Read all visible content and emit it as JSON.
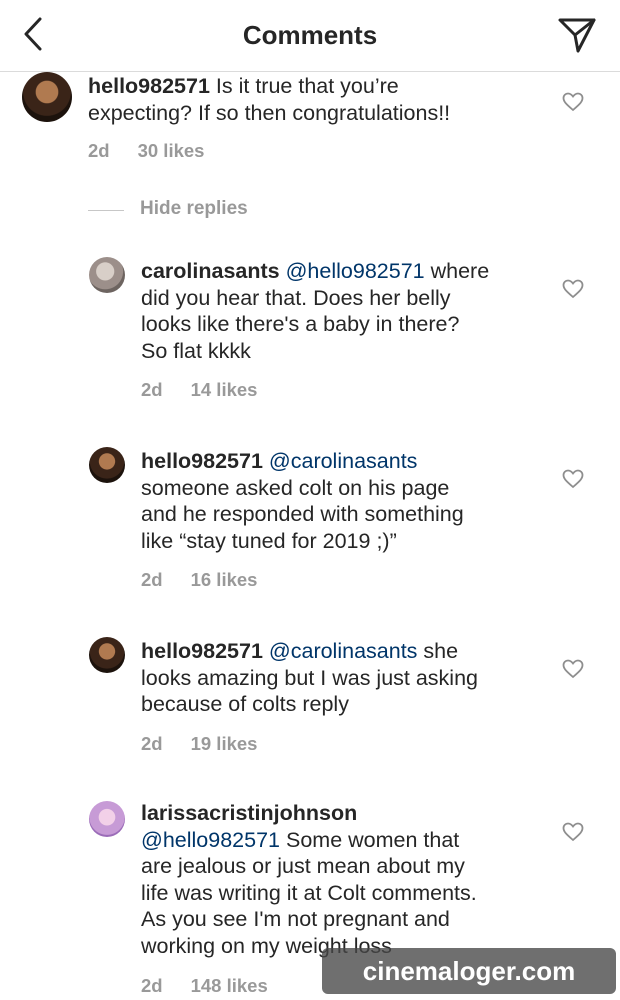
{
  "header": {
    "title": "Comments"
  },
  "comments": [
    {
      "username": "hello982571",
      "mention": "",
      "text_line1": "Is it true that you’re",
      "text_lines": [
        "expecting? If so then congratulations!!"
      ],
      "time": "2d",
      "likes": "30 likes"
    }
  ],
  "replies_toggle": "Hide replies",
  "replies": [
    {
      "username": "carolinasants",
      "mention": "@hello982571",
      "text_line1": "where",
      "text_lines": [
        "did you hear that. Does her belly",
        "looks like there's a baby in there?",
        "So flat kkkk"
      ],
      "time": "2d",
      "likes": "14 likes"
    },
    {
      "username": "hello982571",
      "mention": "@carolinasants",
      "text_line1": "",
      "text_lines": [
        "someone asked colt on his page",
        "and he responded with something",
        "like “stay tuned for 2019 ;)”"
      ],
      "time": "2d",
      "likes": "16 likes"
    },
    {
      "username": "hello982571",
      "mention": "@carolinasants",
      "text_line1": "she",
      "text_lines": [
        "looks amazing but I was just asking",
        "because of colts reply"
      ],
      "time": "2d",
      "likes": "19 likes"
    },
    {
      "username": "larissacristinjohnson",
      "mention": "@hello982571",
      "text_line1": "Some women that",
      "text_lines": [
        "are jealous or just mean about my",
        "life was writing it at Colt comments.",
        "As you see I'm not pregnant and",
        "working on my weight loss"
      ],
      "time": "2d",
      "likes": "148 likes"
    }
  ],
  "watermark": "cinemaloger.com",
  "icons": {
    "back": "chevron-left-icon",
    "send": "paper-plane-icon",
    "like": "heart-outline-icon"
  },
  "colors": {
    "mention": "#003569",
    "meta": "#999999",
    "text": "#262626"
  }
}
